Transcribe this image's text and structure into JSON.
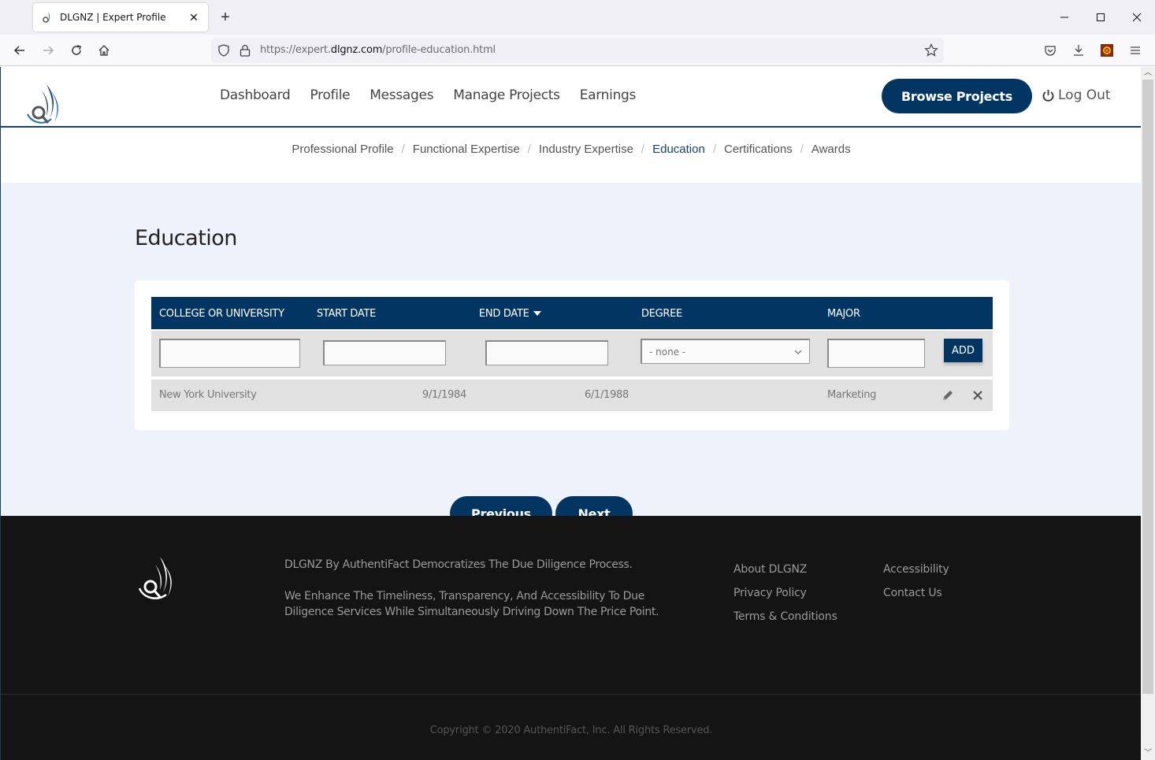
{
  "browser": {
    "tab_title": "DLGNZ | Expert Profile",
    "url_prefix": "https://expert.",
    "url_domain": "dlgnz.com",
    "url_path": "/profile-education.html"
  },
  "header": {
    "nav": [
      "Dashboard",
      "Profile",
      "Messages",
      "Manage Projects",
      "Earnings"
    ],
    "browse_projects": "Browse Projects",
    "logout": "Log Out"
  },
  "subnav": {
    "items": [
      {
        "label": "Professional Profile",
        "active": false
      },
      {
        "label": "Functional Expertise",
        "active": false
      },
      {
        "label": "Industry Expertise",
        "active": false
      },
      {
        "label": "Education",
        "active": true
      },
      {
        "label": "Certifications",
        "active": false
      },
      {
        "label": "Awards",
        "active": false
      }
    ],
    "separator": "/"
  },
  "main": {
    "title": "Education",
    "table": {
      "columns": [
        "COLLEGE OR UNIVERSITY",
        "START DATE",
        "END DATE",
        "DEGREE",
        "MAJOR"
      ],
      "sorted_column": "END DATE",
      "new_entry": {
        "college": "",
        "start_date": "",
        "end_date": "",
        "degree": "- none -",
        "major": ""
      },
      "add_label": "ADD",
      "rows": [
        {
          "college": "New York University",
          "start_date": "9/1/1984",
          "end_date": "6/1/1988",
          "degree": "",
          "major": "Marketing"
        }
      ]
    },
    "previous_label": "Previous",
    "next_label": "Next"
  },
  "footer": {
    "tagline": "DLGNZ By AuthentiFact Democratizes The Due Diligence Process.",
    "description": "We Enhance The Timeliness, Transparency, And Accessibility To Due Diligence Services While Simultaneously Driving Down The Price Point.",
    "links_col1": [
      "About DLGNZ",
      "Privacy Policy",
      "Terms & Conditions"
    ],
    "links_col2": [
      "Accessibility",
      "Contact Us"
    ],
    "copyright": "Copyright © 2020 AuthentiFact, Inc. All Rights Reserved."
  },
  "colors": {
    "brand_navy": "#033563",
    "content_bg": "#eef2fa",
    "footer_bg": "#141414"
  }
}
